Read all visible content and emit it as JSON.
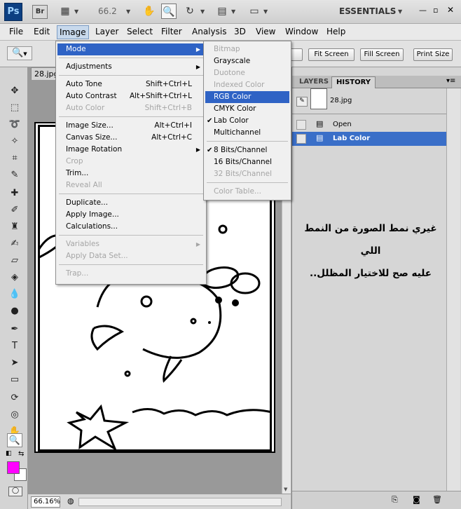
{
  "app": {
    "logo": "Ps",
    "bridge": "Br",
    "zoom": "66.2",
    "workspace": "ESSENTIALS"
  },
  "menubar": [
    "File",
    "Edit",
    "Image",
    "Layer",
    "Select",
    "Filter",
    "Analysis",
    "3D",
    "View",
    "Window",
    "Help"
  ],
  "options_bar": {
    "buttons": [
      "Fit Screen",
      "Fill Screen",
      "Print Size"
    ]
  },
  "document": {
    "tab": "28.jpg",
    "zoom_status": "66.16%"
  },
  "image_menu": [
    {
      "label": "Mode",
      "hi": true,
      "sub": true
    },
    {
      "sep": true
    },
    {
      "label": "Adjustments",
      "sub": true
    },
    {
      "sep": true
    },
    {
      "label": "Auto Tone",
      "sc": "Shift+Ctrl+L"
    },
    {
      "label": "Auto Contrast",
      "sc": "Alt+Shift+Ctrl+L"
    },
    {
      "label": "Auto Color",
      "sc": "Shift+Ctrl+B",
      "dis": true
    },
    {
      "sep": true
    },
    {
      "label": "Image Size...",
      "sc": "Alt+Ctrl+I"
    },
    {
      "label": "Canvas Size...",
      "sc": "Alt+Ctrl+C"
    },
    {
      "label": "Image Rotation",
      "sub": true
    },
    {
      "label": "Crop",
      "dis": true
    },
    {
      "label": "Trim..."
    },
    {
      "label": "Reveal All",
      "dis": true
    },
    {
      "sep": true
    },
    {
      "label": "Duplicate..."
    },
    {
      "label": "Apply Image..."
    },
    {
      "label": "Calculations..."
    },
    {
      "sep": true
    },
    {
      "label": "Variables",
      "dis": true,
      "sub": true
    },
    {
      "label": "Apply Data Set...",
      "dis": true
    },
    {
      "sep": true
    },
    {
      "label": "Trap...",
      "dis": true
    }
  ],
  "mode_submenu": [
    {
      "label": "Bitmap",
      "dis": true
    },
    {
      "label": "Grayscale"
    },
    {
      "label": "Duotone",
      "dis": true
    },
    {
      "label": "Indexed Color",
      "dis": true
    },
    {
      "label": "RGB Color",
      "hi": true
    },
    {
      "label": "CMYK Color"
    },
    {
      "label": "Lab Color",
      "checked": true
    },
    {
      "label": "Multichannel"
    },
    {
      "sep": true
    },
    {
      "label": "8 Bits/Channel",
      "checked": true
    },
    {
      "label": "16 Bits/Channel"
    },
    {
      "label": "32 Bits/Channel",
      "dis": true
    },
    {
      "sep": true
    },
    {
      "label": "Color Table...",
      "dis": true
    }
  ],
  "panel": {
    "tabs": [
      "LAYERS",
      "HISTORY"
    ],
    "snapshot": "28.jpg",
    "history": [
      {
        "label": "Open",
        "sel": false
      },
      {
        "label": "Lab Color",
        "sel": true
      }
    ]
  },
  "annotation": {
    "line1": "غيري نمط الصورة من النمط اللي",
    "line2": "عليه صح للاختيار المظلل.."
  },
  "colors": {
    "foreground": "#ff00ff",
    "background": "#ffffff",
    "highlight": "#2f63c5"
  }
}
